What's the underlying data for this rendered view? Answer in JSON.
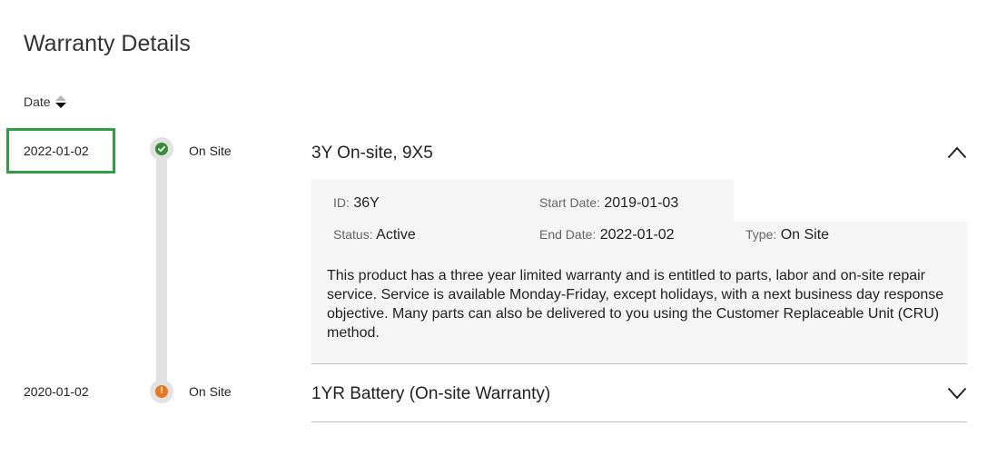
{
  "page": {
    "title": "Warranty Details"
  },
  "sort": {
    "label": "Date"
  },
  "warranties": [
    {
      "date": "2022-01-02",
      "type": "On Site",
      "name": "3Y On-site, 9X5",
      "expanded": true,
      "status_color": "#3a8a3a",
      "icon": "check-icon",
      "details": {
        "id_label": "ID:",
        "id_value": "36Y",
        "start_label": "Start Date:",
        "start_value": "2019-01-03",
        "status_label": "Status:",
        "status_value": "Active",
        "end_label": "End Date:",
        "end_value": "2022-01-02",
        "type_label": "Type:",
        "type_value": "On Site",
        "description": "This product has a three year limited warranty and is entitled to parts, labor and on-site repair service. Service is available Monday-Friday, except holidays, with a next business day response objective. Many parts can also be delivered to you using the Customer Replaceable Unit (CRU) method."
      }
    },
    {
      "date": "2020-01-02",
      "type": "On Site",
      "name": "1YR Battery (On-site Warranty)",
      "expanded": false,
      "status_color": "#e87722",
      "icon": "exclamation-icon"
    }
  ]
}
